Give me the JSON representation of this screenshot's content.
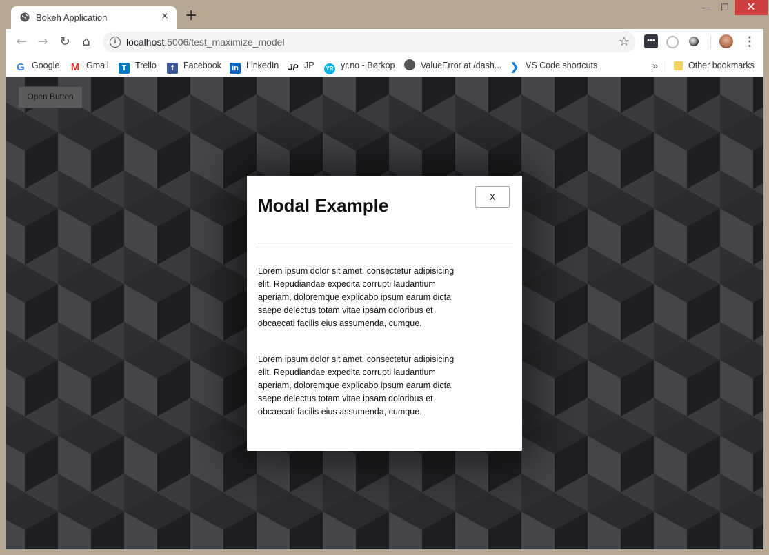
{
  "browser": {
    "tab_title": "Bokeh Application",
    "tab_close": "×",
    "new_tab": "+",
    "window_controls": {
      "minimize": "—",
      "maximize": "☐",
      "close": "✕"
    },
    "url_host": "localhost",
    "url_rest": ":5006/test_maximize_model",
    "nav": {
      "back": "←",
      "forward": "→",
      "reload": "↻",
      "home": "⌂"
    },
    "extensions": [
      "notifications-icon",
      "speed-dial-icon",
      "record-icon"
    ],
    "bookmarks": [
      {
        "label": "Google",
        "icon": "G"
      },
      {
        "label": "Gmail",
        "icon": "M"
      },
      {
        "label": "Trello",
        "icon": "T"
      },
      {
        "label": "Facebook",
        "icon": "f"
      },
      {
        "label": "LinkedIn",
        "icon": "in"
      },
      {
        "label": "JP",
        "icon": "JP"
      },
      {
        "label": "yr.no - Børkop",
        "icon": "YR"
      },
      {
        "label": "ValueError at /dash...",
        "icon": ""
      },
      {
        "label": "VS Code shortcuts",
        "icon": "❯"
      }
    ],
    "bookmarks_more": "»",
    "other_bookmarks": "Other bookmarks"
  },
  "page": {
    "open_button": "Open Button",
    "modal": {
      "title": "Modal Example",
      "close_label": "X",
      "paragraphs": [
        "Lorem ipsum dolor sit amet, consectetur adipisicing elit. Repudiandae expedita corrupti laudantium aperiam, doloremque explicabo ipsum earum dicta saepe delectus totam vitae ipsam doloribus et obcaecati facilis eius assumenda, cumque.",
        "Lorem ipsum dolor sit amet, consectetur adipisicing elit. Repudiandae expedita corrupti laudantium aperiam, doloremque explicabo ipsum earum dicta saepe delectus totam vitae ipsam doloribus et obcaecati facilis eius assumenda, cumque."
      ]
    }
  },
  "colors": {
    "frame": "#b6a795",
    "page_background": "#26272a",
    "cube_light": "#44454a",
    "cube_mid": "#2e2f33",
    "cube_dark": "#1e1f22"
  }
}
